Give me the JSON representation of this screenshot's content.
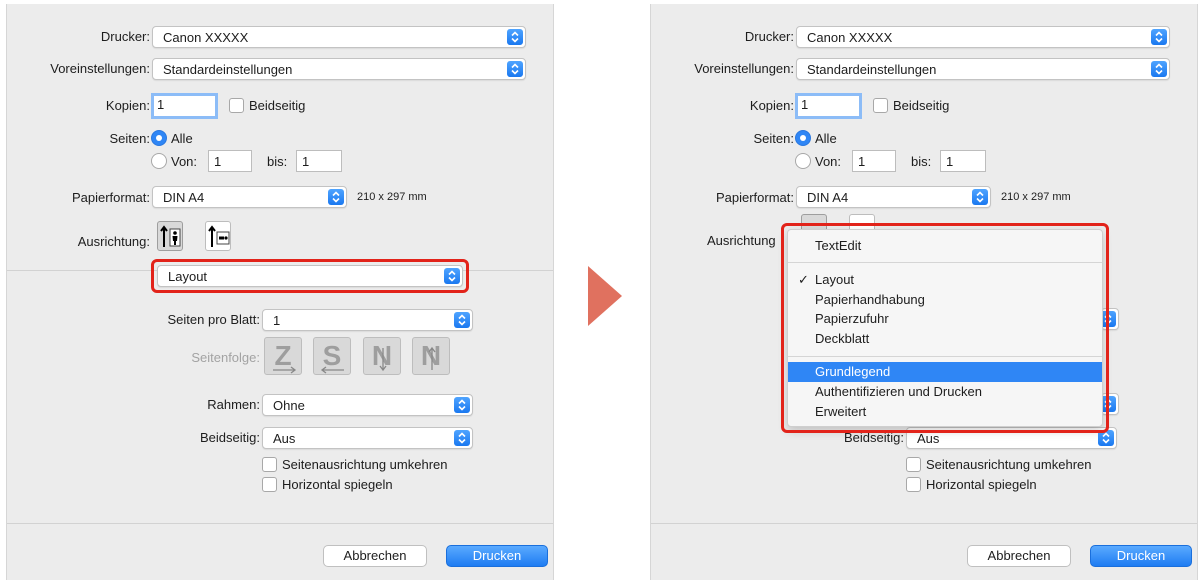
{
  "dialog": {
    "drucker_label": "Drucker:",
    "drucker_value": "Canon XXXXX",
    "voreinstellungen_label": "Voreinstellungen:",
    "voreinstellungen_value": "Standardeinstellungen",
    "kopien_label": "Kopien:",
    "kopien_value": "1",
    "beidseitig_check_label": "Beidseitig",
    "seiten_label": "Seiten:",
    "alle_label": "Alle",
    "von_label": "Von:",
    "von_value": "1",
    "bis_label": "bis:",
    "bis_value": "1",
    "papierformat_label": "Papierformat:",
    "papierformat_value": "DIN A4",
    "papier_size": "210 x 297 mm",
    "ausrichtung_label": "Ausrichtung:",
    "ausrichtung_label_cut": "Ausrichtung",
    "section_value": "Layout",
    "seiten_pro_blatt_label": "Seiten pro Blatt:",
    "seiten_pro_blatt_value": "1",
    "seitenfolge_label": "Seitenfolge:",
    "seitenfolge_glyphs": [
      "Z",
      "S",
      "N",
      "N"
    ],
    "rahmen_label": "Rahmen:",
    "rahmen_value": "Ohne",
    "beidseitig_label": "Beidseitig:",
    "beidseitig_value": "Aus",
    "seitenausrichtung_label": "Seitenausrichtung umkehren",
    "horizontal_label": "Horizontal spiegeln",
    "cancel_label": "Abbrechen",
    "print_label": "Drucken"
  },
  "menu": {
    "items_group1": [
      "TextEdit"
    ],
    "items_group2": [
      "Layout",
      "Papierhandhabung",
      "Papierzufuhr",
      "Deckblatt"
    ],
    "items_group3": [
      "Grundlegend",
      "Authentifizieren und Drucken",
      "Erweitert"
    ],
    "checked_item": "Layout",
    "highlighted_item": "Grundlegend",
    "check_glyph": "✓"
  },
  "colors": {
    "accent": "#2f86f5",
    "highlight_frame": "#e2231a",
    "arrow": "#e0715f",
    "panel_bg": "#ececec"
  }
}
